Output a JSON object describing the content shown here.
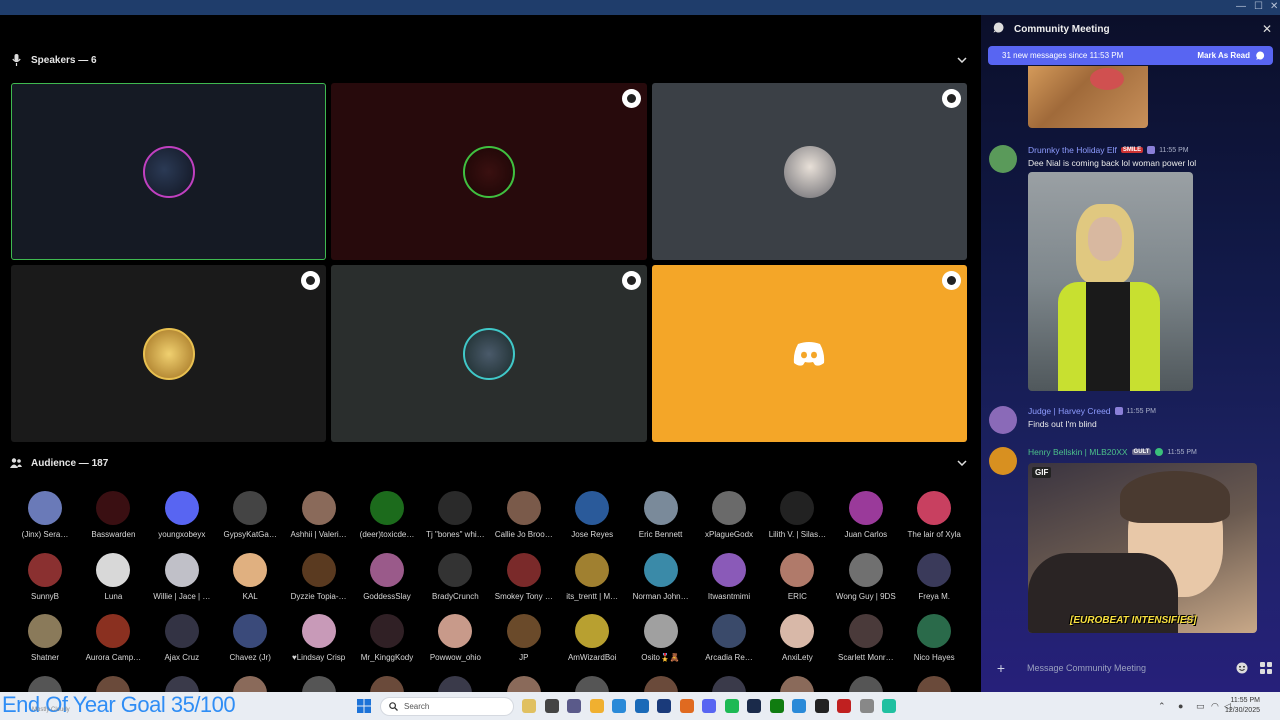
{
  "window": {
    "minimize": "—",
    "maximize": "☐",
    "close": "✕"
  },
  "speakers": {
    "label": "Speakers — 6"
  },
  "audience": {
    "label": "Audience — 187",
    "members": [
      "(Jinx) Sera…",
      "Basswarden",
      "youngxobeyx",
      "GypsyKatGa…",
      "Ashhii | Valeri…",
      "(deer)toxicde…",
      "Tj \"bones\" whi…",
      "Callie Jo Broo…",
      "Jose Reyes",
      "Eric Bennett",
      "xPlagueGodx",
      "Lilith V. | Silas…",
      "Juan Carlos",
      "The lair of Xyla",
      "SunnyB",
      "Luna",
      "Willie | Jace | …",
      "KAL",
      "Dyzzie Topia-…",
      "GoddessSlay",
      "BradyCrunch",
      "Smokey Tony …",
      "its_trentt | M…",
      "Norman John…",
      "Itwasntmimi",
      "ERIC",
      "Wong Guy | 9DS",
      "Freya M.",
      "Shatner",
      "Aurora Camp…",
      "Ajax Cruz",
      "Chavez (Jr)",
      "♥Lindsay Crisp",
      "Mr_KinggKody",
      "Powwow_ohio",
      "JP",
      "AmWizardBoi",
      "Osito🎖️🧸",
      "Arcadia Re…",
      "AnxiLety",
      "Scarlett Monr…",
      "Nico Hayes"
    ],
    "colors": [
      "#6a7ab8",
      "#3a0f12",
      "#5865f2",
      "#444",
      "#8a6a5a",
      "#1c6b1c",
      "#2a2a2a",
      "#7a5a4a",
      "#2a5a9a",
      "#7a8a9a",
      "#6a6a6a",
      "#222",
      "#9a3a9a",
      "#c84060",
      "#8a3030",
      "#d8d8d8",
      "#c0c0c8",
      "#e0b080",
      "#5a3a20",
      "#9a5a8a",
      "#333",
      "#7a2a2a",
      "#a08030",
      "#3a8aa8",
      "#8a5ab8",
      "#b07a6a",
      "#707070",
      "#3a3a5a",
      "#8a7a5a",
      "#8a3020",
      "#334",
      "#3a4a7a",
      "#c89ab8",
      "#302025",
      "#c89a8a",
      "#6a4a2a",
      "#b8a030",
      "#a0a0a0",
      "#3a4a6a",
      "#d8b8a8",
      "#4a3a3a",
      "#2a6a4a"
    ]
  },
  "chat": {
    "title": "Community Meeting",
    "close": "✕",
    "new_messages": "31 new messages since 11:53 PM",
    "mark_as_read": "Mark As Read",
    "messages": [
      {
        "user": "Drunnky the Holiday Elf",
        "tag": "SMILE",
        "time": "11:55 PM",
        "text": "Dee Nial is coming back lol woman power lol",
        "color": "#5a9a5a"
      },
      {
        "user": "Judge | Harvey Creed",
        "time": "11:55 PM",
        "text": "Finds out I'm blind",
        "color": "#8a6ab8"
      },
      {
        "user": "Henry Bellskin | MLB20XX",
        "tag": "GULT",
        "time": "11:55 PM",
        "text": "",
        "color": "#d89020"
      }
    ],
    "gif_label": "GIF",
    "gif_caption": "[EUROBEAT INTENSIFIES]",
    "composer_placeholder": "Message Community Meeting"
  },
  "taskbar": {
    "goal": "End Of Year Goal 35/100",
    "watermark": "Mostly Cloudy",
    "search": "Search",
    "time": "11:55 PM",
    "date": "12/30/2025"
  },
  "accent": "#5865f2",
  "discord_tile_color": "#f4a628"
}
